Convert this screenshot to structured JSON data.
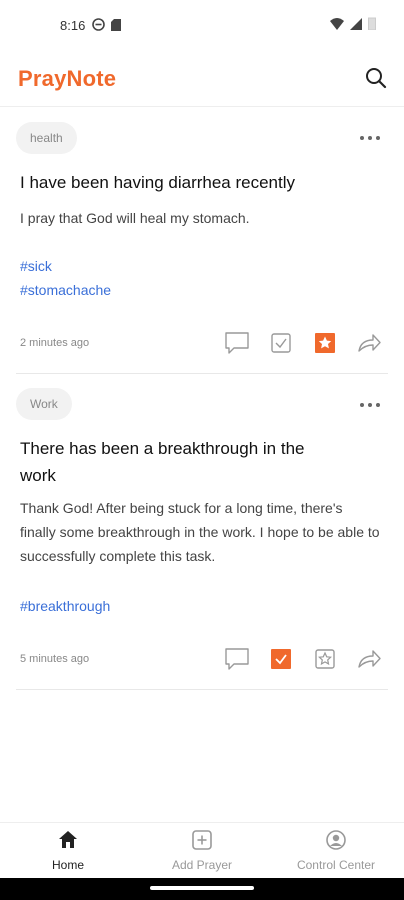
{
  "status_bar": {
    "time": "8:16"
  },
  "app": {
    "title": "PrayNote"
  },
  "accent": "#f0692c",
  "link_color": "#3a6fd8",
  "posts": [
    {
      "tag": "health",
      "title": "I have been having diarrhea recently",
      "body": "I pray that God will heal my stomach.",
      "hashtags": [
        "#sick",
        "#stomachache"
      ],
      "time": "2 minutes ago",
      "done": false,
      "starred": true
    },
    {
      "tag": "Work",
      "title": "There has been a breakthrough in the work",
      "body": "Thank God! After being stuck for a long time, there's finally some breakthrough in the work. I hope to be able to successfully complete this task.",
      "hashtags": [
        "#breakthrough"
      ],
      "time": "5 minutes ago",
      "done": true,
      "starred": false
    }
  ],
  "nav": [
    {
      "label": "Home",
      "icon": "home-icon",
      "active": true
    },
    {
      "label": "Add Prayer",
      "icon": "add-square-icon",
      "active": false
    },
    {
      "label": "Control Center",
      "icon": "user-circle-icon",
      "active": false
    }
  ]
}
